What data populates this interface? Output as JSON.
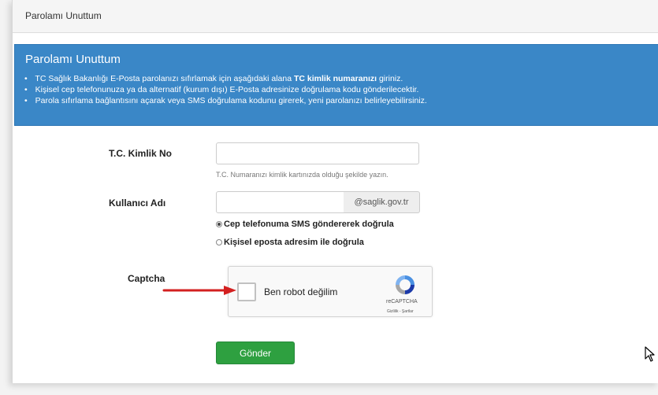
{
  "panel": {
    "heading": "Parolamı Unuttum"
  },
  "info": {
    "title": "Parolamı Unuttum",
    "bullets": [
      {
        "before": "TC Sağlık Bakanlığı E-Posta parolanızı sıfırlamak için aşağıdaki alana ",
        "bold": "TC kimlik numaranızı",
        "after": " giriniz."
      },
      {
        "before": "Kişisel cep telefonunuza ya da alternatif (kurum dışı) E-Posta adresinize doğrulama kodu gönderilecektir.",
        "bold": "",
        "after": ""
      },
      {
        "before": "Parola sıfırlama bağlantısını açarak veya SMS doğrulama kodunu girerek, yeni parolanızı belirleyebilirsiniz.",
        "bold": "",
        "after": ""
      }
    ]
  },
  "form": {
    "tc_label": "T.C. Kimlik No",
    "tc_value": "",
    "tc_help": "T.C. Numaranızı kimlik kartınızda olduğu şekilde yazın.",
    "username_label": "Kullanıcı Adı",
    "username_value": "",
    "domain_addon": "@saglik.gov.tr",
    "radio_sms": "Cep telefonuma SMS göndererek doğrula",
    "radio_email": "Kişisel eposta adresim ile doğrula",
    "captcha_label": "Captcha",
    "captcha_text": "Ben robot değilim",
    "captcha_brand": "reCAPTCHA",
    "captcha_links": "Gizlilik - Şartlar",
    "submit_label": "Gönder"
  },
  "colors": {
    "info_bg": "#3a87c7",
    "submit_bg": "#2ea040",
    "arrow": "#d32020"
  }
}
